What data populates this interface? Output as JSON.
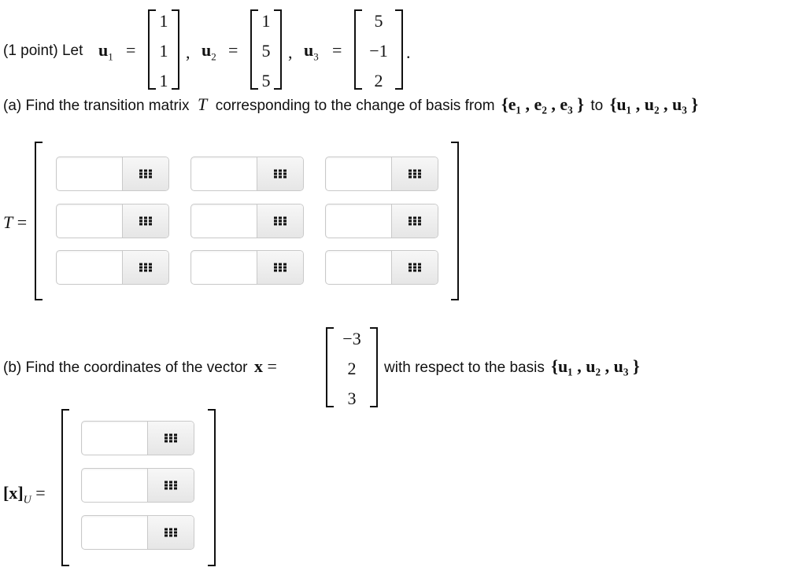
{
  "intro": {
    "prefix": "(1 point) Let",
    "u1_label": "u",
    "u1_sub": "1",
    "u2_label": "u",
    "u2_sub": "2",
    "u3_label": "u",
    "u3_sub": "3",
    "eq": "=",
    "comma": ",",
    "period": "."
  },
  "vectors": {
    "u1": [
      "1",
      "1",
      "1"
    ],
    "u2": [
      "1",
      "5",
      "5"
    ],
    "u3": [
      "5",
      "−1",
      "2"
    ]
  },
  "part_a": {
    "text_prefix": "(a) Find the transition matrix",
    "T": "T",
    "text_middle": "corresponding to the change of basis from",
    "from_basis": "{e₁ , e₂ , e₃ }",
    "to_word": "to",
    "to_basis": "{u₁ , u₂ , u₃ }",
    "matrix_label": "T =",
    "rows": 3,
    "cols": 3
  },
  "part_b": {
    "text_prefix": "(b) Find the coordinates of the vector",
    "x_label": "x =",
    "x_vector": [
      "−3",
      "2",
      "3"
    ],
    "text_suffix": "with respect to the basis",
    "basis": "{u₁ , u₂ , u₃ }",
    "answer_label": "[x]",
    "answer_sub": "U",
    "answer_eq": "="
  },
  "icons": {
    "palette": "grid-icon"
  }
}
